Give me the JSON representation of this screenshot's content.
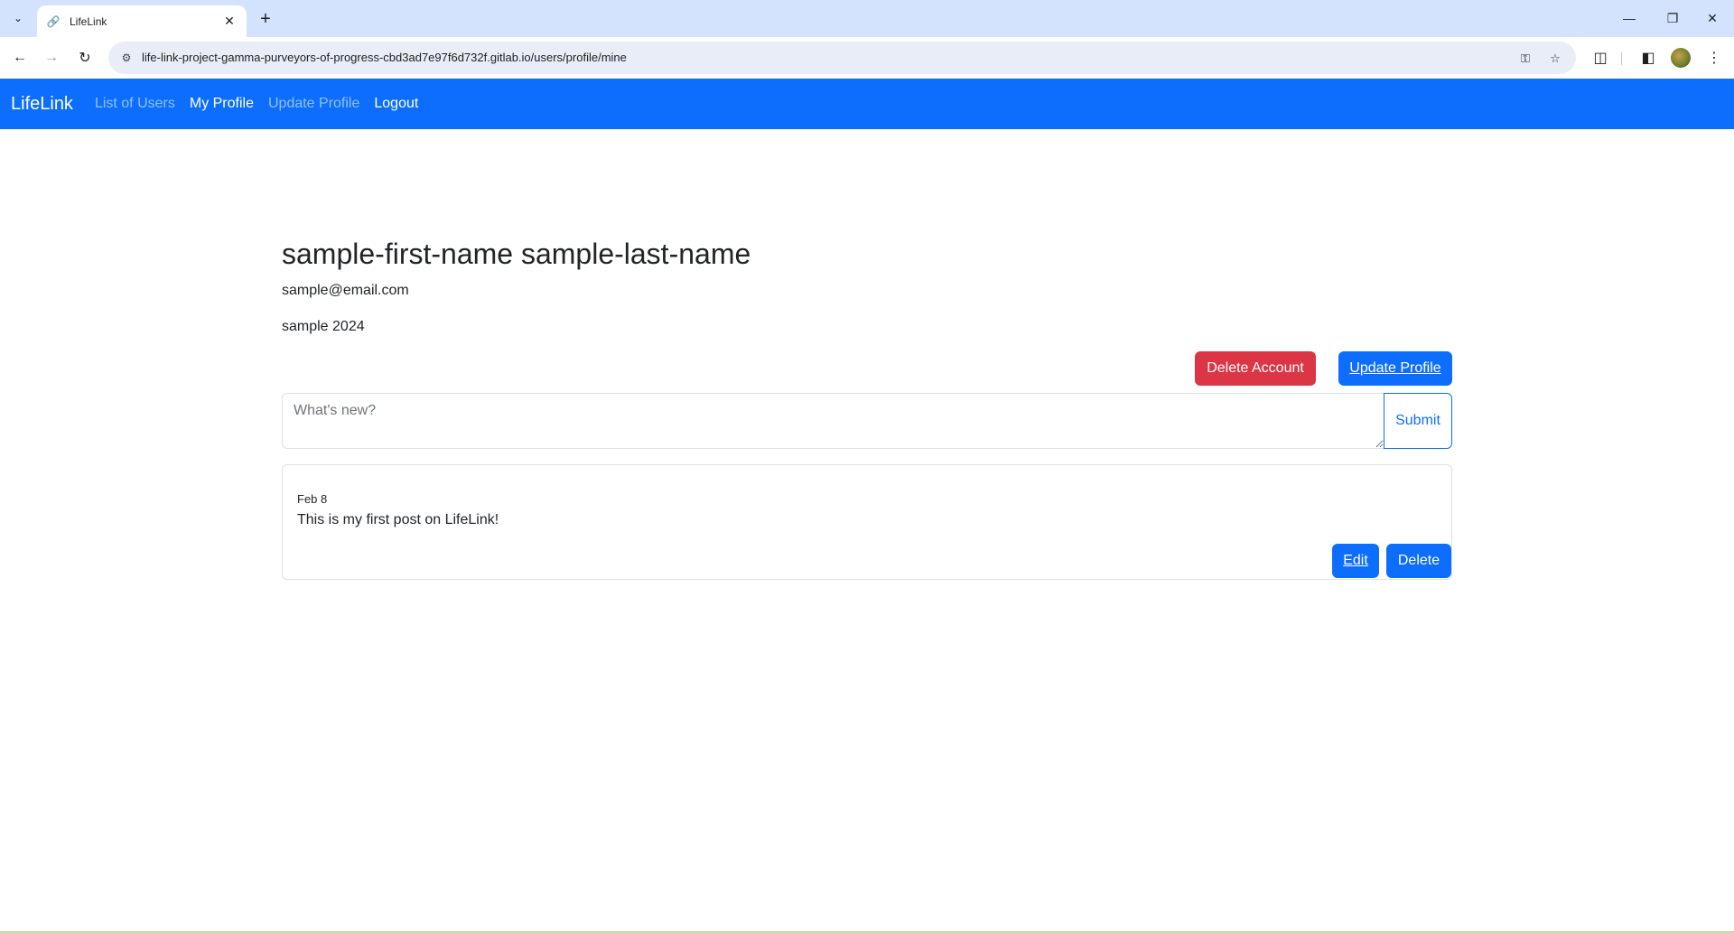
{
  "browser": {
    "tab_title": "LifeLink",
    "url": "life-link-project-gamma-purveyors-of-progress-cbd3ad7e97f6d732f.gitlab.io/users/profile/mine"
  },
  "navbar": {
    "brand": "LifeLink",
    "links": [
      "List of Users",
      "My Profile",
      "Update Profile",
      "Logout"
    ]
  },
  "profile": {
    "name": "sample-first-name sample-last-name",
    "email": "sample@email.com",
    "bio": "sample 2024",
    "delete_account_label": "Delete Account",
    "update_profile_label": "Update Profile"
  },
  "composer": {
    "placeholder": "What's new?",
    "submit_label": "Submit"
  },
  "posts": [
    {
      "date": "Feb 8",
      "text": "This is my first post on LifeLink!",
      "edit_label": "Edit",
      "delete_label": "Delete"
    }
  ],
  "colors": {
    "primary": "#0d6efd",
    "danger": "#dc3545",
    "tabstrip": "#d3e3fd"
  }
}
